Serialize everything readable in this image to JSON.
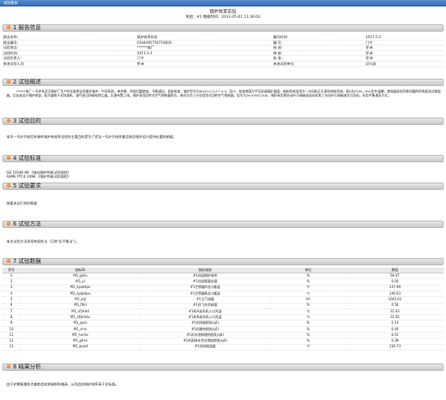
{
  "window_title": "试验报表",
  "doc": {
    "title": "锅炉效率实验",
    "subtitle": "机组：#1 数据时间：2011-05-01 11:36:03"
  },
  "sections": {
    "s1": "1 报告信息",
    "s2": "2 试验概述",
    "s3": "3 试验目的",
    "s4": "4 试验标准",
    "s5": "5 试验要求",
    "s6": "6 试验方法",
    "s7": "7 试验数据",
    "s8": "8 结果分析"
  },
  "info": [
    [
      "报告名称:",
      "锅炉效率实验",
      "编写时间:",
      "2011-5-1"
    ],
    [
      "报告编号:",
      "6344495759716600",
      "编 写：",
      "门宁"
    ],
    [
      "试验地点:",
      "******电厂",
      "校 阅：",
      "罗洲"
    ],
    [
      "试验时间:",
      "2011-5-1",
      "审 核：",
      "罗洲"
    ],
    [
      "试验负责人：",
      "门宁",
      "批 准：",
      "罗洲"
    ],
    [
      "参加试验人员:",
      "罗洲",
      "参加试验单位:",
      "运行部"
    ]
  ],
  "overview": "******电厂一号炉系武汉锅炉厂生产的亚临界自然循环锅炉，中间再热，单炉膛、四角切圆燃烧，平衡通风，固态排渣，锅炉型号为WGZ1111/17.5-3，设计、校核燃煤为平顶灵烟煤矿烟煤，制粉系统采用冷一次风机正压直吹制粉系统，配5台ZGM—95G型中速磨，燃烧器采用四角切圆的四角直流式燃烧器，后出成设计锅炉底部，配冷器和干式排渣机，烟气经过四级电除尘器，后通布置二排，锅炉采用回转式空气预热器两台，每台均为三分仓容克式回转空气预热器，型号为29.5VNT2200，锅炉采用两台动叶可调轴流送风机和三台动叶可调轴流式引风机，采用平衡通风方式。",
  "purpose": "本次一号炉大修后所做的锅炉热效率试验的主要目的是为了验证一号炉大修质量及指导锅炉运行提供必要的依据。",
  "standards": [
    "GB 10184-88 《电站锅炉性能试验规程》",
    "ASME PTC4-1998 《锅炉性能试验规程》"
  ],
  "requirement": "按要求运行到时数据",
  "method": "本次试验方法采用热损失法（又称\"反平衡法\"）。",
  "table": {
    "headers": [
      "序号",
      "指标ID",
      "指标描述",
      "单位",
      "数值"
    ],
    "rows": [
      [
        "1",
        "M1_glxlv",
        "#1机组锅炉效率",
        "%",
        "94.07"
      ],
      [
        "2",
        "M1_yl",
        "#1机组氧量含量",
        "%",
        "0.00"
      ],
      [
        "3",
        "M1_kyqkdpe",
        "#1空预器A出口烟温",
        "℃",
        "147.99"
      ],
      [
        "4",
        "M1_kyqkdpu",
        "#1空预器B出口烟温",
        "℃",
        "146.63"
      ],
      [
        "5",
        "M1_zql",
        "#1主汽流量",
        "t/h",
        "1042.61"
      ],
      [
        "6",
        "M1_fhkl",
        "#1机飞灰含碳量",
        "%",
        "0.56"
      ],
      [
        "7",
        "M1_sfjrkdd",
        "#1机A送风机入口风温",
        "℃",
        "22.63"
      ],
      [
        "8",
        "M1_sfjbrkdu",
        "#1机B送风机入口风温",
        "℃",
        "22.65"
      ],
      [
        "9",
        "M1_pyss",
        "#1机排烟损失(q2)",
        "%",
        "5.14"
      ],
      [
        "10",
        "M1_srss",
        "#1机散热损失(q5)",
        "%",
        "0.40"
      ],
      [
        "11",
        "M1_hxrlss",
        "#1机灰渣物理热损失(q6)",
        "%",
        "0.01"
      ],
      [
        "12",
        "M1_gtrss",
        "#1机固体未完全燃烧损失(q4)",
        "%",
        "0.38"
      ],
      [
        "13",
        "M1_pywd",
        "#1机排烟温度",
        "℃",
        "136.73"
      ]
    ]
  },
  "analysis": "由于炉膛氧量和点偏差造成排烟损失偏高，从而造成锅炉效率高于实际值。"
}
